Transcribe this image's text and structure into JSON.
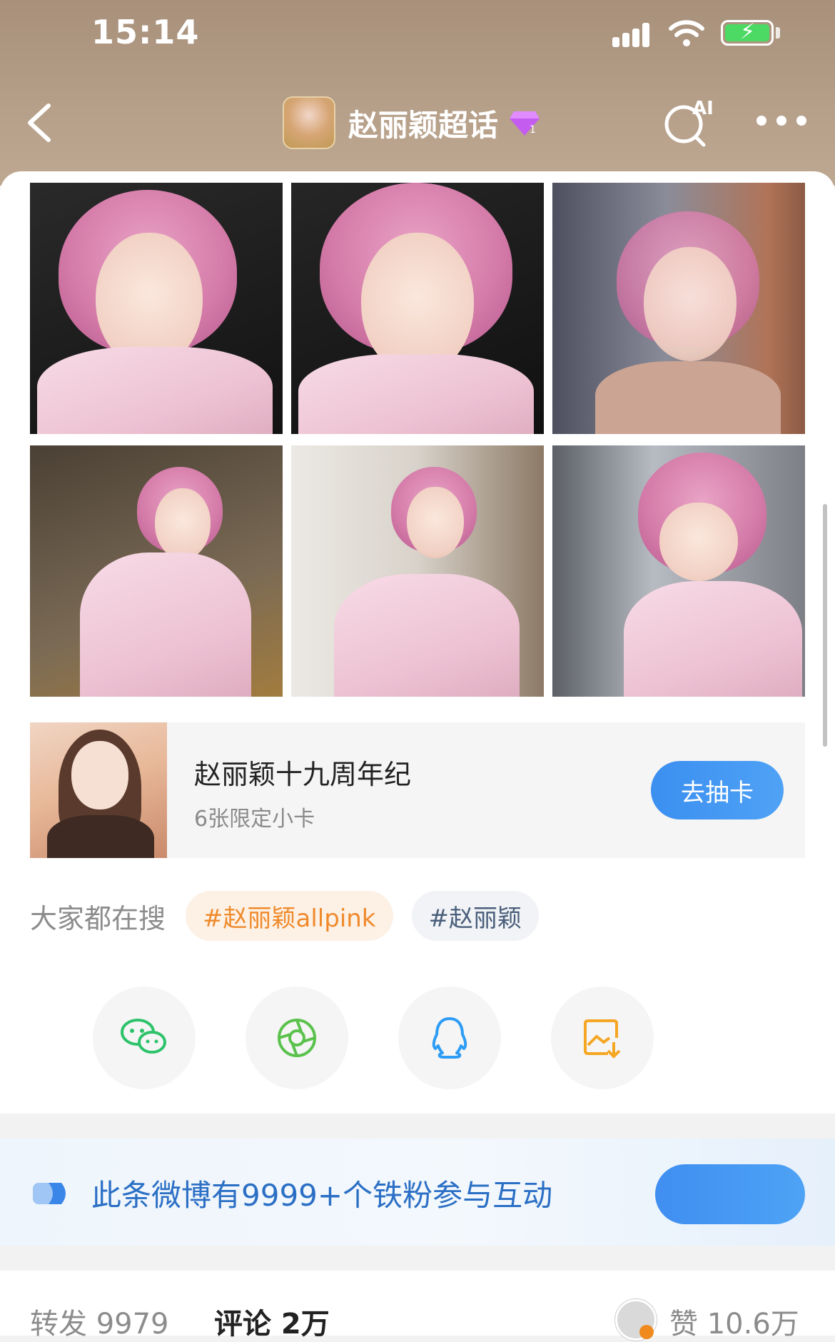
{
  "status_bar": {
    "time": "15:14"
  },
  "header": {
    "title": "赵丽颖超话"
  },
  "photos": [
    {
      "bg": "#1d1d1d"
    },
    {
      "bg": "#1b1b1b"
    },
    {
      "bg": "#6d6e7a"
    },
    {
      "bg": "#6b5d4c"
    },
    {
      "bg": "#c9c4bd"
    },
    {
      "bg": "#8a8d92"
    }
  ],
  "promo": {
    "title": "赵丽颖十九周年纪",
    "subtitle": "6张限定小卡",
    "button": "去抽卡"
  },
  "hot_search": {
    "label": "大家都在搜",
    "tags": [
      "#赵丽颖allpink",
      "#赵丽颖"
    ]
  },
  "share": [
    {
      "icon": "wechat-icon",
      "color": "#2dc36a"
    },
    {
      "icon": "moments-icon",
      "color": "#5ac24c"
    },
    {
      "icon": "qq-icon",
      "color": "#2d9cf5"
    },
    {
      "icon": "save-image-icon",
      "color": "#f5a623"
    }
  ],
  "fans_bar": {
    "text": "此条微博有9999+个铁粉参与互动"
  },
  "bottom_bar": {
    "repost": "转发 9979",
    "comment": "评论 2万",
    "like": "赞 10.6万"
  }
}
